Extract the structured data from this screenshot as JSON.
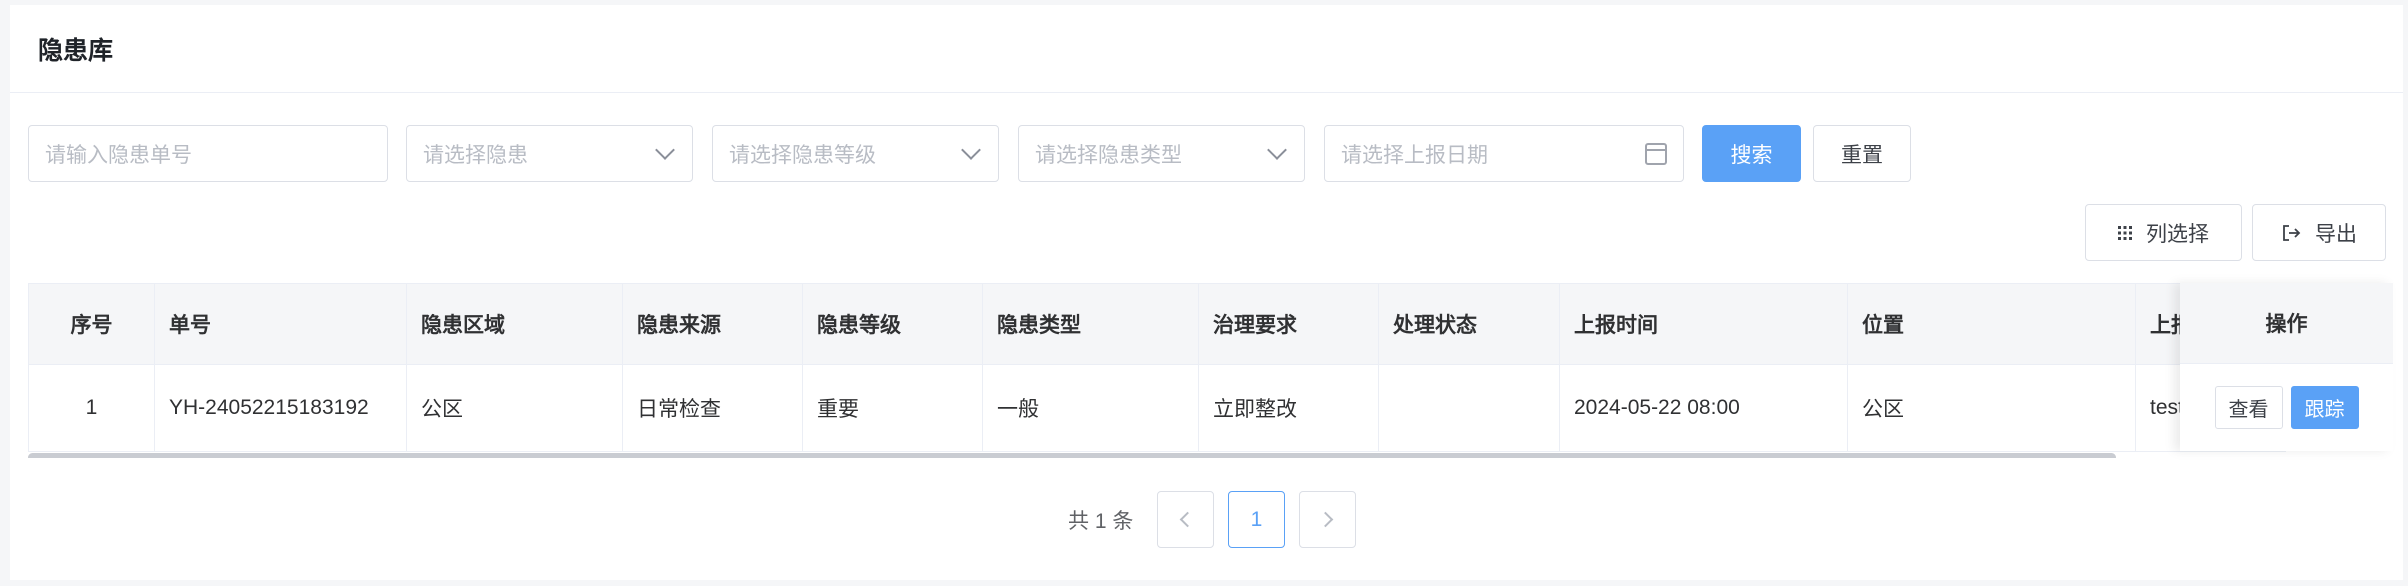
{
  "header": {
    "title": "隐患库"
  },
  "filters": {
    "order_no_placeholder": "请输入隐患单号",
    "hazard_placeholder": "请选择隐患",
    "level_placeholder": "请选择隐患等级",
    "type_placeholder": "请选择隐患类型",
    "date_placeholder": "请选择上报日期",
    "search_label": "搜索",
    "reset_label": "重置"
  },
  "toolbar": {
    "columns_label": "列选择",
    "export_label": "导出"
  },
  "table": {
    "columns": [
      "序号",
      "单号",
      "隐患区域",
      "隐患来源",
      "隐患等级",
      "隐患类型",
      "治理要求",
      "处理状态",
      "上报时间",
      "位置",
      "上报人"
    ],
    "rows": [
      [
        "1",
        "YH-24052215183192",
        "公区",
        "日常检查",
        "重要",
        "一般",
        "立即整改",
        "",
        "2024-05-22 08:00",
        "公区",
        "test"
      ]
    ],
    "action_header": "操作",
    "actions": {
      "view": "查看",
      "track": "跟踪"
    }
  },
  "pagination": {
    "total_text": "共 1 条",
    "current_page": "1"
  },
  "colors": {
    "primary": "#5aa1f6",
    "header_bg": "#f5f6f8",
    "border": "#dcdfe6"
  }
}
